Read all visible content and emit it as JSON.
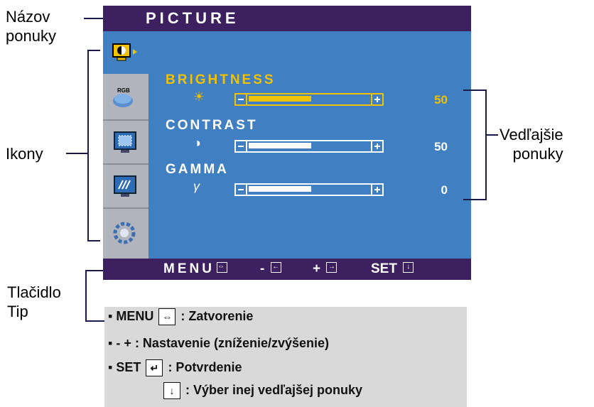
{
  "osd": {
    "title": "PICTURE",
    "icons": [
      "picture-icon",
      "rgb-icon",
      "screen-icon",
      "gamma-icon",
      "settings-icon"
    ],
    "icon_rgb_label": "RGB",
    "items": [
      {
        "label": "BRIGHTNESS",
        "symbol": "☀",
        "value": "50",
        "level": 0.5,
        "active": true
      },
      {
        "label": "CONTRAST",
        "symbol": "◑",
        "value": "50",
        "level": 0.5,
        "active": false
      },
      {
        "label": "GAMMA",
        "symbol": "γ",
        "value": "0",
        "level": 0.5,
        "active": false
      }
    ],
    "bottom": {
      "menu": "MENU",
      "minus": "-",
      "plus": "+",
      "set": "SET"
    },
    "colors": {
      "title_bar": "#3d2060",
      "body": "#3f7fc2",
      "active": "#f2c200"
    }
  },
  "callouts": {
    "menu_name_line1": "Názov",
    "menu_name_line2": "ponuky",
    "icons": "Ikony",
    "submenus_line1": "Vedľajšie",
    "submenus_line2": "ponuky",
    "tip_line1": "Tlačidlo",
    "tip_line2": "Tip"
  },
  "tips": {
    "menu_label": "MENU",
    "menu_desc": ": Zatvorenie",
    "minus": "-",
    "plus": "+",
    "adjust_desc": ": Nastavenie (zníženie/zvýšenie)",
    "set_label": "SET",
    "set_desc": ": Potvrdenie",
    "down_desc": ": Výber inej vedľajšej ponuky"
  }
}
